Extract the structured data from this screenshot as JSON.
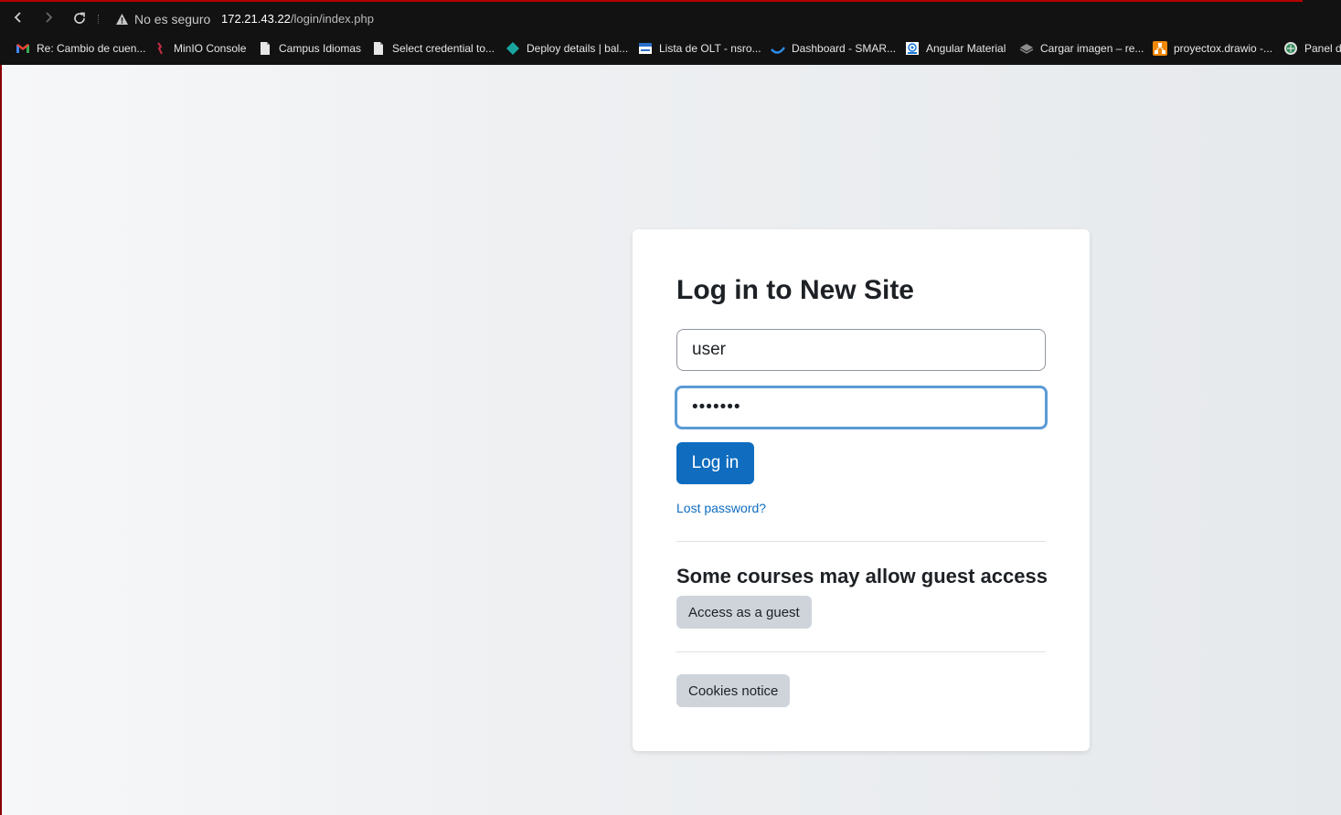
{
  "browser": {
    "security_label": "No es seguro",
    "url_host": "172.21.43.22",
    "url_path": "/login/index.php",
    "bookmarks": [
      {
        "label": "Re: Cambio de cuen...",
        "icon": "gmail-icon"
      },
      {
        "label": "MinIO Console",
        "icon": "minio-icon"
      },
      {
        "label": "Campus Idiomas",
        "icon": "page-icon"
      },
      {
        "label": "Select credential to...",
        "icon": "page-icon"
      },
      {
        "label": "Deploy details | bal...",
        "icon": "diamond-icon"
      },
      {
        "label": "Lista de OLT - nsro...",
        "icon": "olt-icon"
      },
      {
        "label": "Dashboard - SMAR...",
        "icon": "dashboard-icon"
      },
      {
        "label": "Angular Material",
        "icon": "angular-material-icon"
      },
      {
        "label": "Cargar imagen – re...",
        "icon": "layers-icon"
      },
      {
        "label": "proyectox.drawio -...",
        "icon": "drawio-icon"
      },
      {
        "label": "Panel d",
        "icon": "panel-icon"
      }
    ]
  },
  "login": {
    "title": "Log in to New Site",
    "username_value": "user",
    "password_value": "•••••••",
    "login_button": "Log in",
    "lost_password": "Lost password?",
    "guest_heading": "Some courses may allow guest access",
    "guest_button": "Access as a guest",
    "cookies_button": "Cookies notice"
  },
  "colors": {
    "primary": "#0f6cbf",
    "secondary_button": "#ced4da",
    "focus_ring": "#5b9bd5",
    "chrome_bg": "#121212"
  }
}
